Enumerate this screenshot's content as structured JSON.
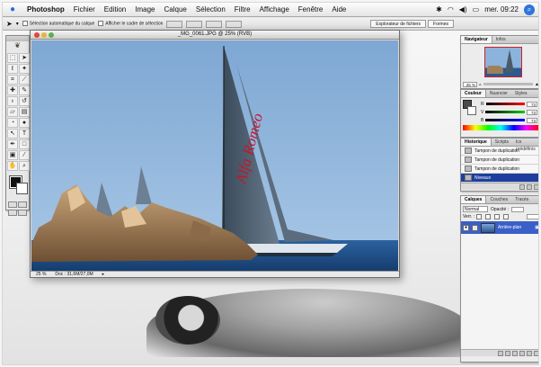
{
  "menubar": {
    "app": "Photoshop",
    "items": [
      "Fichier",
      "Edition",
      "Image",
      "Calque",
      "Sélection",
      "Filtre",
      "Affichage",
      "Fenêtre",
      "Aide"
    ],
    "clock": "mer. 09:22"
  },
  "optionsbar": {
    "auto_select": "Sélection automatique du calque",
    "show_bbox": "Afficher le cadre de sélection",
    "tab_browser": "Explorateur de fichiers",
    "tab_brushes": "Formes"
  },
  "document": {
    "title": "_MG_0061.JPG @ 25% (RVB)",
    "zoom": "25 %",
    "doc_size": "Doc : 31,6M/27,0M",
    "sail_text": "Alfa Romeo"
  },
  "navigator": {
    "tabs": [
      "Navigateur",
      "Infos"
    ],
    "zoom": "25 %"
  },
  "color": {
    "tabs": [
      "Couleur",
      "Nuancier",
      "Styles"
    ],
    "channels": [
      {
        "label": "R",
        "value": "73"
      },
      {
        "label": "V",
        "value": "73"
      },
      {
        "label": "B",
        "value": "73"
      }
    ]
  },
  "history": {
    "tabs": [
      "Historique",
      "Scripts",
      "Ics prédéfinis"
    ],
    "items": [
      "Tampon de duplication",
      "Tampon de duplication",
      "Tampon de duplication",
      "Niveaux"
    ]
  },
  "layers": {
    "tabs": [
      "Calques",
      "Couches",
      "Tracés"
    ],
    "blend": "Normal",
    "opacity_label": "Opacité :",
    "lock_label": "Verr. :",
    "layer_name": "Arrière-plan"
  },
  "colors": {
    "highlight": "#1d3e9c",
    "sky": "#93b9de",
    "sea": "#1f4f86"
  }
}
